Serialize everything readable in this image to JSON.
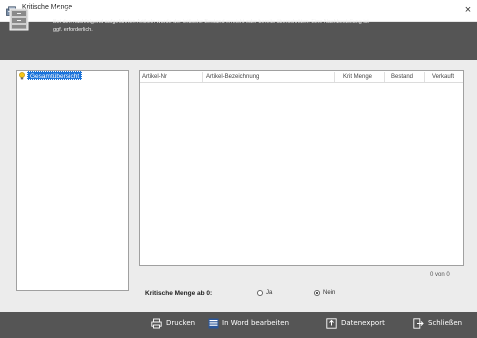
{
  "window": {
    "title": "Kritische Menge",
    "close_symbol": "×"
  },
  "header": {
    "title": "Kritische Menge - Nachbestellung",
    "description": "Bei den nachfolgend aufgeführten Artikeln wurde der kritische Bestand erreicht oder bereits überschritten. Eine Nachbestellung ist ggf. erforderlich."
  },
  "tree": {
    "items": [
      {
        "label": "Gesamtübersicht",
        "selected": true
      }
    ]
  },
  "table": {
    "columns": [
      "Artikel-Nr",
      "Artikel-Bezeichnung",
      "Krit Menge",
      "Bestand",
      "Verkauft"
    ],
    "rows": [],
    "count_text": "0 von 0"
  },
  "filter": {
    "label": "Kritische Menge ab 0:",
    "options": [
      {
        "label": "Ja",
        "selected": false
      },
      {
        "label": "Nein",
        "selected": true
      }
    ]
  },
  "footer": {
    "buttons": [
      {
        "label": "Drucken",
        "icon": "printer-icon"
      },
      {
        "label": "In Word bearbeiten",
        "icon": "word-icon"
      },
      {
        "label": "Datenexport",
        "icon": "export-icon"
      },
      {
        "label": "Schließen",
        "icon": "exit-icon"
      }
    ]
  },
  "colors": {
    "header_bg": "#555555",
    "selection": "#1a73d9",
    "panel_bg": "#ececec"
  }
}
